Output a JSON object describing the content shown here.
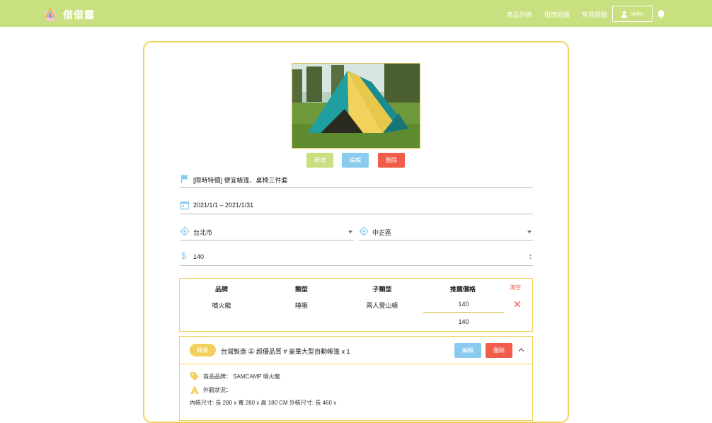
{
  "header": {
    "brand": "借借露",
    "nav": [
      "商品列表",
      "租借紀錄",
      "常見問題"
    ],
    "user_label": "seller"
  },
  "actions": {
    "add": "新增",
    "edit": "編輯",
    "delete": "刪除"
  },
  "form": {
    "title": "[限時特價] 便宜帳篷、桌椅三件套",
    "date_range": "2021/1/1 – 2021/1/31",
    "city": "台北市",
    "district": "中正區",
    "price": "140"
  },
  "table": {
    "headers": [
      "品牌",
      "類型",
      "子類型",
      "推薦價格"
    ],
    "clear_label": "清空",
    "rows": [
      {
        "brand": "噴火龍",
        "type": "睡帳",
        "subtype": "兩人登山帳",
        "price": "140"
      }
    ],
    "total": "140"
  },
  "product": {
    "tag": "睡帳",
    "title": "台灣製造 ㊣ 超優品質 # 豪華大型自動帳篷 x 1",
    "edit_label": "編輯",
    "delete_label": "刪除",
    "brand_line": "商品品牌： SAMCAMP 噴火龍",
    "appearance_line": "外觀狀況：",
    "size_line": "內帳尺寸: 長 280 x 寬 280 x 高 180 CM 外帳尺寸: 長 460 x"
  },
  "colors": {
    "header_bg": "#c9e080",
    "card_border": "#f2d05a",
    "edit": "#8ccbf0",
    "delete": "#f25c4b",
    "icon": "#8ccbf0"
  }
}
